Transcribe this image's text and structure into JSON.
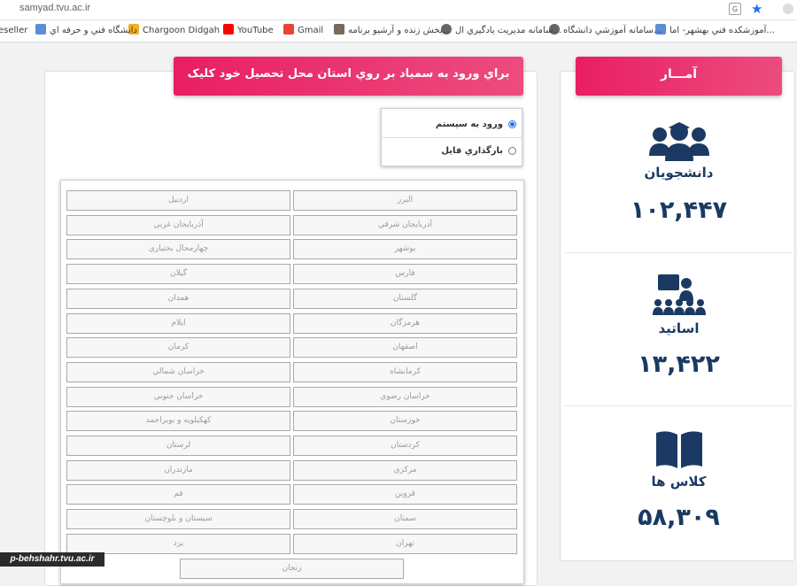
{
  "browser": {
    "url": "samyad.tvu.ac.ir",
    "bookmarks": [
      {
        "label": "آموزشکده فني بهشهر- اما..."
      },
      {
        "label": "سامانه آموزشي دانشگاه..."
      },
      {
        "label": "سامانه مديريت يادگيري ال..."
      },
      {
        "label": "بخش زنده و آرشيو برنامه..."
      },
      {
        "label": "Gmail"
      },
      {
        "label": "YouTube"
      },
      {
        "label": "Chargoon Didgah"
      },
      {
        "label": "دانشگاه فني و حرفه اي"
      },
      {
        "label": "eseller"
      }
    ]
  },
  "left": {
    "header": "براي ورود به سمياد بر روي استان محل تحصيل خود کليک نماييد",
    "modes": [
      {
        "label": "ورود به سيستم",
        "checked": true
      },
      {
        "label": "بارگذاري فايل",
        "checked": false
      }
    ],
    "provinces": [
      "البرز",
      "اردبيل",
      "آذربايجان شرقي",
      "آذربايجان غربي",
      "بوشهر",
      "چهارمحال بختياري",
      "فارس",
      "گيلان",
      "گلستان",
      "همدان",
      "هرمزگان",
      "ايلام",
      "اصفهان",
      "کرمان",
      "کرمانشاه",
      "خراسان شمالي",
      "خراسان رضوي",
      "خراسان جنوبي",
      "خوزستان",
      "کهکيلويه و بويراحمد",
      "کردستان",
      "لرستان",
      "مرکزي",
      "مازندران",
      "قزوين",
      "قم",
      "سمنان",
      "سيستان و بلوچستان",
      "تهران",
      "يزد",
      "زنجان"
    ]
  },
  "right": {
    "header": "آمـــار",
    "stats": [
      {
        "label": "دانشجويان",
        "value": "۱۰۲,۴۴۷",
        "icon": "students-icon"
      },
      {
        "label": "اساتيد",
        "value": "۱۳,۴۲۲",
        "icon": "teachers-icon"
      },
      {
        "label": "کلاس ها",
        "value": "۵۸,۳۰۹",
        "icon": "book-icon"
      }
    ]
  },
  "watermark": "p-behshahr.tvu.ac.ir",
  "colors": {
    "accent": "#e91e63",
    "stat_text": "#1a3a63"
  }
}
